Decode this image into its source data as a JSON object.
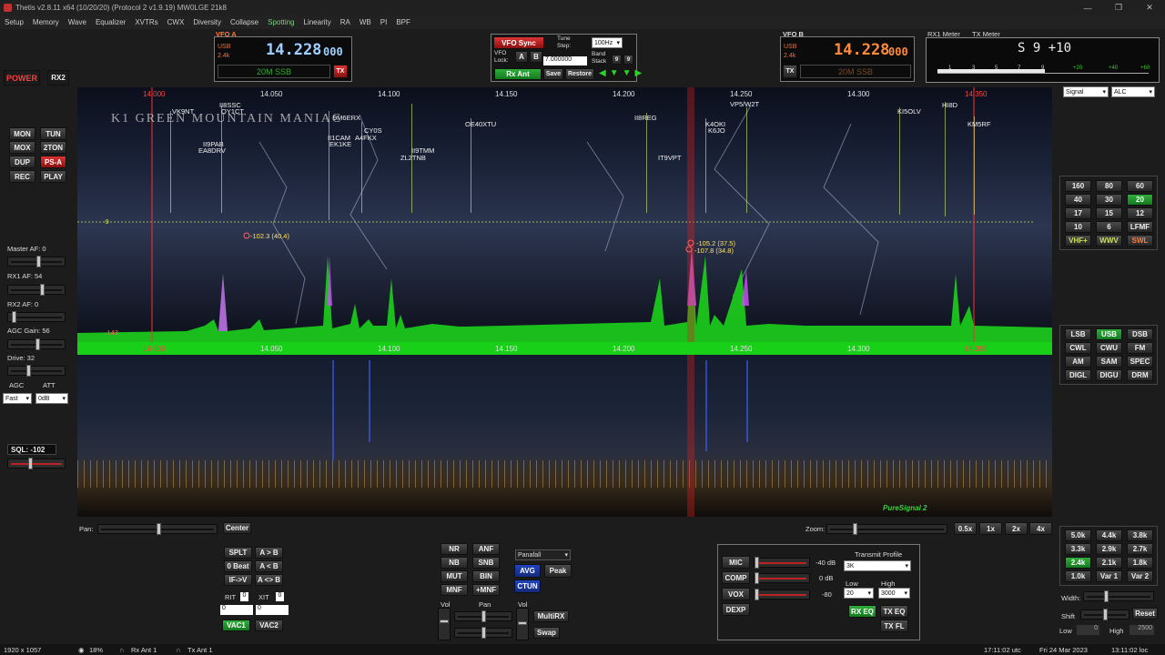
{
  "titlebar": {
    "title": "Thetis v2.8.11 x64 (10/20/20) (Protocol 2 v1.9.19) MW0LGE 21k8"
  },
  "menu": [
    "Setup",
    "Memory",
    "Wave",
    "Equalizer",
    "XVTRs",
    "CWX",
    "Diversity",
    "Collapse",
    "Spotting",
    "Linearity",
    "RA",
    "WB",
    "PI",
    "BPF"
  ],
  "left": {
    "power": "POWER",
    "rx2": "RX2",
    "mon": "MON",
    "tun": "TUN",
    "mox": "MOX",
    "twoton": "2TON",
    "dup": "DUP",
    "psa": "PS-A",
    "rec": "REC",
    "play": "PLAY",
    "master_af": "Master AF:  0",
    "rx1_af": "RX1 AF:  54",
    "rx2_af": "RX2 AF:  0",
    "agc_gain": "AGC Gain:  56",
    "drive": "Drive:  32",
    "agc": "AGC",
    "att": "ATT",
    "agc_val": "Fast",
    "att_val": "0dB",
    "sql": "SQL: -102"
  },
  "vfoa": {
    "title": "VFO A",
    "mode": "USB",
    "bw": "2.4k",
    "freq": "14.228",
    "freq_small": "000",
    "band": "20M SSB",
    "tx": "TX"
  },
  "vfoctl": {
    "sync": "VFO Sync",
    "tune_step": "Tune Step:",
    "step_val": "100Hz",
    "lock": "VFO Lock:",
    "a": "A",
    "b": "B",
    "lock_val": "7.000000",
    "band_stack": "Band Stack",
    "bs1": "9",
    "bs2": "9",
    "rxant": "Rx Ant",
    "save": "Save",
    "restore": "Restore"
  },
  "vfob": {
    "title": "VFO B",
    "mode": "USB",
    "bw": "2.4k",
    "freq": "14.228",
    "freq_small": "000",
    "band": "20M SSB",
    "tx": "TX"
  },
  "meter": {
    "rx1": "RX1 Meter",
    "tx": "TX Meter",
    "reading": "S 9 +10",
    "scale": [
      "1",
      "3",
      "5",
      "7",
      "9",
      "+20",
      "+40",
      "+60"
    ],
    "sel1": "Signal",
    "sel2": "ALC"
  },
  "spectrum": {
    "top_ticks": [
      "14.000",
      "14.050",
      "14.100",
      "14.150",
      "14.200",
      "14.250",
      "14.300",
      "14.350"
    ],
    "bottom_ticks": [
      "14.000",
      "14.050",
      "14.100",
      "14.150",
      "14.200",
      "14.250",
      "14.300",
      "14.350"
    ],
    "watermark": "K1 GREEN MOUNTAIN MANIAC",
    "spots": [
      "VK9NT",
      "II8SSC",
      "OY1CT",
      "9M6ERX",
      "II9PAB",
      "EA8DRV",
      "II1CAM",
      "A4FKX",
      "EK1KE",
      "CY0S",
      "ZL2TNB",
      "II9TMM",
      "OE40XTU",
      "II8REG",
      "IT9VPT",
      "K4OKI",
      "K6JO",
      "VP5/W2T",
      "KI5OLV",
      "HI8D",
      "KM5RF"
    ],
    "markers": [
      "-102.3 (40.4)",
      "-105.2 (37.5)",
      "-107.8 (34.8)"
    ],
    "grid_left": "-9",
    "floor": "-143",
    "puresignal": "PureSignal 2"
  },
  "pan": {
    "label": "Pan:",
    "center": "Center",
    "zoom": "Zoom:",
    "z1": "0.5x",
    "z2": "1x",
    "z3": "2x",
    "z4": "4x"
  },
  "bands": [
    "160",
    "80",
    "60",
    "40",
    "30",
    "20",
    "17",
    "15",
    "12",
    "10",
    "6",
    "LFMF",
    "VHF+",
    "WWV",
    "SWL"
  ],
  "modes": [
    "LSB",
    "USB",
    "DSB",
    "CWL",
    "CWU",
    "FM",
    "AM",
    "SAM",
    "SPEC",
    "DIGL",
    "DIGU",
    "DRM"
  ],
  "filters": [
    "5.0k",
    "4.4k",
    "3.8k",
    "3.3k",
    "2.9k",
    "2.7k",
    "2.4k",
    "2.1k",
    "1.8k",
    "1.0k",
    "Var 1",
    "Var 2"
  ],
  "filterctl": {
    "width": "Width:",
    "shift": "Shift",
    "reset": "Reset",
    "low": "Low",
    "low_val": "0",
    "high": "High",
    "high_val": "2500"
  },
  "bottomleft": {
    "splt": "SPLT",
    "atob": "A > B",
    "zbeat": "0 Beat",
    "btoa": "A < B",
    "iftov": "IF->V",
    "aswap": "A <> B",
    "rit": "RIT",
    "rit_val": "0",
    "xit": "XIT",
    "xit_val": "0",
    "vac1": "VAC1",
    "vac2": "VAC2"
  },
  "dsp": {
    "nr": "NR",
    "anf": "ANF",
    "nb": "NB",
    "snb": "SNB",
    "mut": "MUT",
    "bin": "BIN",
    "mnf": "MNF",
    "pmnf": "+MNF",
    "display": "Panafall",
    "avg": "AVG",
    "peak": "Peak",
    "ctun": "CTUN",
    "vol": "Vol",
    "pan": "Pan",
    "vol2": "Vol",
    "multirx": "MultiRX",
    "swap": "Swap"
  },
  "tx": {
    "mic": "MIC",
    "mic_val": "-40 dB",
    "comp": "COMP",
    "comp_val": "0 dB",
    "vox": "VOX",
    "vox_val": "-80",
    "dexp": "DEXP",
    "profile": "Transmit Profile",
    "profile_val": "3K",
    "low": "Low",
    "high": "High",
    "low_val": "20",
    "high_val": "3000",
    "rxeq": "RX EQ",
    "txeq": "TX EQ",
    "txfl": "TX FL"
  },
  "status": {
    "res": "1920 x 1057",
    "cpu": "18%",
    "rxant": "Rx Ant 1",
    "txant": "Tx Ant 1",
    "utc": "17:11:02 utc",
    "date": "Fri 24 Mar 2023",
    "loc": "13:11:02 loc"
  }
}
